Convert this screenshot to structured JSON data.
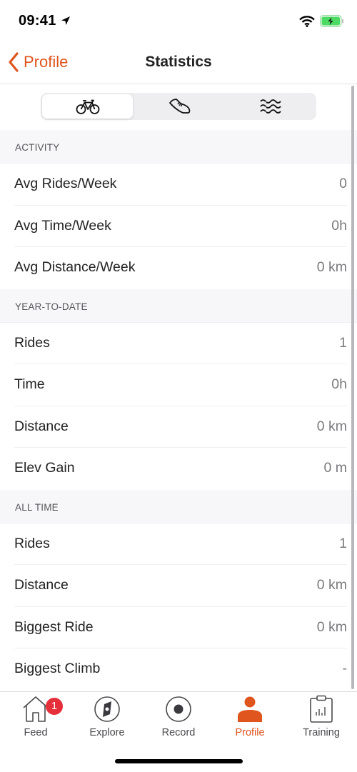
{
  "status_bar": {
    "time": "09:41",
    "icons": [
      "location-arrow-icon",
      "wifi-icon",
      "battery-charging-icon"
    ],
    "battery_color": "#4cd964"
  },
  "nav": {
    "back_label": "Profile",
    "title": "Statistics",
    "accent": "#e0541e"
  },
  "segments": [
    {
      "icon": "bike-icon",
      "selected": true
    },
    {
      "icon": "running-shoe-icon",
      "selected": false
    },
    {
      "icon": "swim-waves-icon",
      "selected": false
    }
  ],
  "sections": [
    {
      "header": "ACTIVITY",
      "rows": [
        {
          "label": "Avg Rides/Week",
          "value": "0"
        },
        {
          "label": "Avg Time/Week",
          "value": "0h"
        },
        {
          "label": "Avg Distance/Week",
          "value": "0 km"
        }
      ]
    },
    {
      "header": "YEAR-TO-DATE",
      "rows": [
        {
          "label": "Rides",
          "value": "1"
        },
        {
          "label": "Time",
          "value": "0h"
        },
        {
          "label": "Distance",
          "value": "0 km"
        },
        {
          "label": "Elev Gain",
          "value": "0 m"
        }
      ]
    },
    {
      "header": "ALL TIME",
      "rows": [
        {
          "label": "Rides",
          "value": "1"
        },
        {
          "label": "Distance",
          "value": "0 km"
        },
        {
          "label": "Biggest Ride",
          "value": "0 km"
        },
        {
          "label": "Biggest Climb",
          "value": "-"
        }
      ]
    }
  ],
  "tabs": [
    {
      "label": "Feed",
      "icon": "home-icon",
      "badge": "1",
      "active": false
    },
    {
      "label": "Explore",
      "icon": "compass-icon",
      "active": false
    },
    {
      "label": "Record",
      "icon": "record-icon",
      "active": false
    },
    {
      "label": "Profile",
      "icon": "person-icon",
      "active": true
    },
    {
      "label": "Training",
      "icon": "clipboard-chart-icon",
      "active": false
    }
  ]
}
